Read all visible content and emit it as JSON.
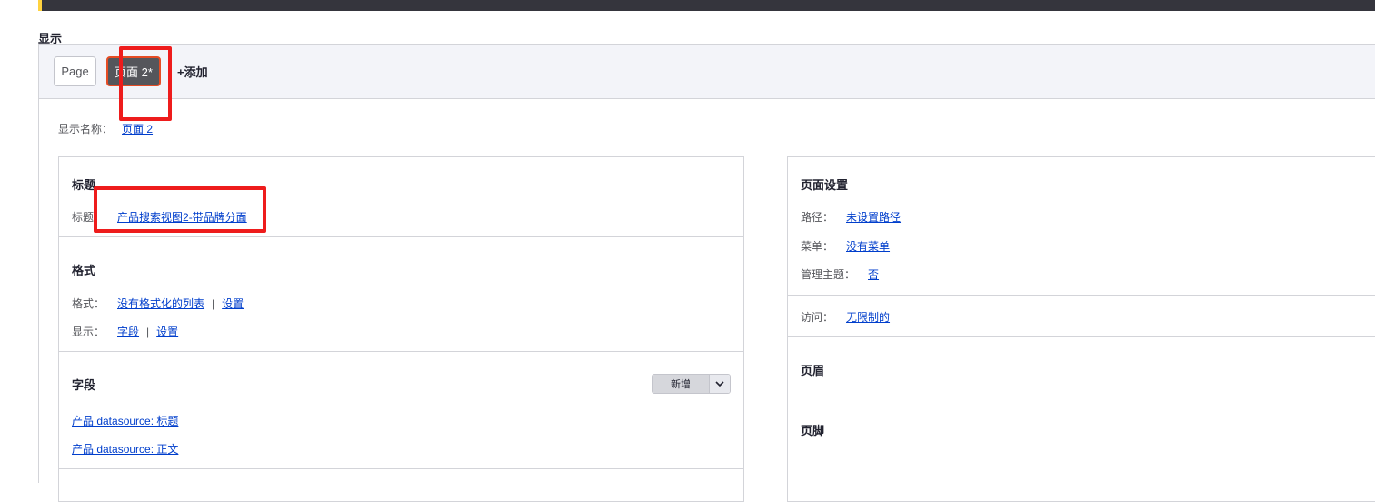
{
  "section_label": "显示",
  "tabs": [
    {
      "label": "Page"
    },
    {
      "label": "页面 2*"
    }
  ],
  "add_display": "+添加",
  "display_name": {
    "label": "显示名称：",
    "value": "页面 2"
  },
  "title_section": {
    "heading": "标题",
    "label": "标题：",
    "value": "产品搜索视图2-带品牌分面"
  },
  "format_section": {
    "heading": "格式",
    "format_label": "格式：",
    "format_value": "没有格式化的列表",
    "format_settings": "设置",
    "show_label": "显示：",
    "show_value": "字段",
    "show_settings": "设置",
    "separator": "|"
  },
  "fields_section": {
    "heading": "字段",
    "add_button": "新增",
    "items": [
      "产品 datasource: 标题",
      "产品 datasource: 正文"
    ]
  },
  "page_settings": {
    "heading": "页面设置",
    "path_label": "路径：",
    "path_value": "未设置路径",
    "menu_label": "菜单：",
    "menu_value": "没有菜单",
    "admin_theme_label": "管理主题：",
    "admin_theme_value": "否"
  },
  "access": {
    "label": "访问：",
    "value": "无限制的"
  },
  "header_section": {
    "heading": "页眉"
  },
  "footer_section": {
    "heading": "页脚"
  },
  "colors": {
    "accent_border": "#e64c24",
    "annotation_red": "#ee1c1c",
    "link": "#003ecc"
  },
  "icons": {
    "dropdown_toggle": "chevron-down-icon"
  }
}
